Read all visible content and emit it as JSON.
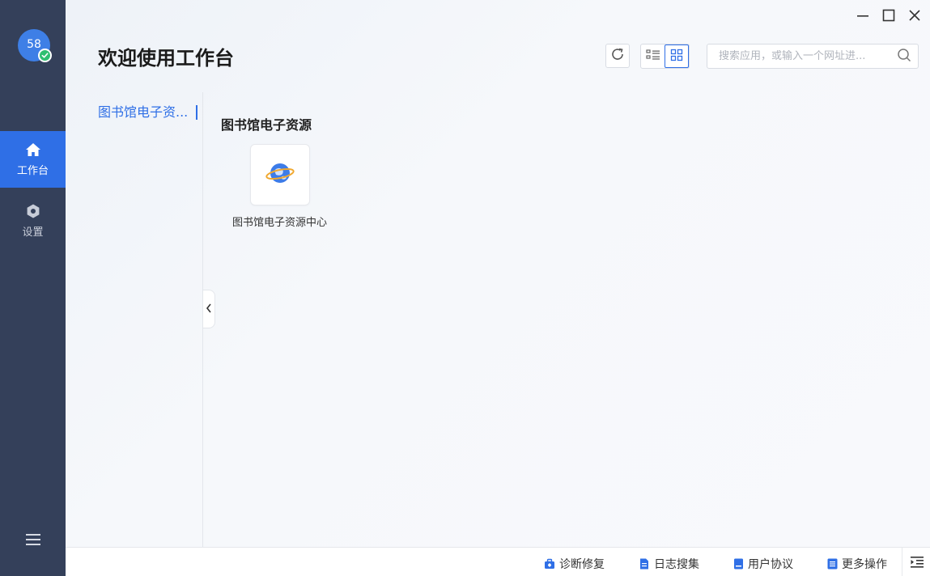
{
  "sidebar": {
    "avatar_text": "58",
    "nav": [
      {
        "label": "工作台",
        "icon": "home-icon",
        "active": true
      },
      {
        "label": "设置",
        "icon": "gear-icon",
        "active": false
      }
    ],
    "menu_icon": "hamburger-menu-icon"
  },
  "header": {
    "title": "欢迎使用工作台",
    "search_placeholder": "搜索应用，或输入一个网址进..."
  },
  "categories": [
    {
      "label": "图书馆电子资...",
      "active": true
    }
  ],
  "section": {
    "title": "图书馆电子资源",
    "apps": [
      {
        "label": "图书馆电子资源中心",
        "icon": "globe-planet-icon"
      }
    ]
  },
  "footer": {
    "items": [
      {
        "label": "诊断修复",
        "icon": "toolbox-icon"
      },
      {
        "label": "日志搜集",
        "icon": "document-icon"
      },
      {
        "label": "用户协议",
        "icon": "bookmark-icon"
      },
      {
        "label": "更多操作",
        "icon": "list-icon"
      }
    ]
  },
  "colors": {
    "sidebar_bg": "#34405a",
    "accent": "#2f6fe6",
    "status_ok": "#2fbf71"
  }
}
